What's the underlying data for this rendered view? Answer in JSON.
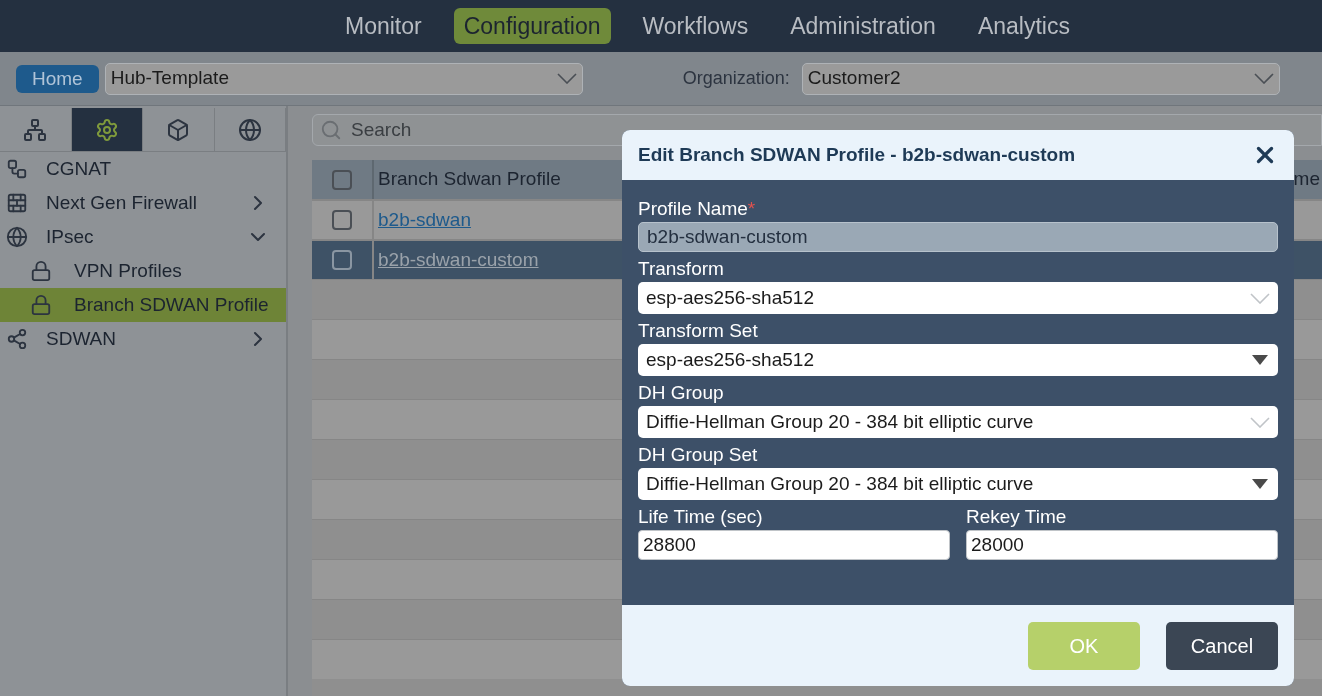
{
  "nav": {
    "items": [
      {
        "label": "Monitor",
        "selected": false
      },
      {
        "label": "Configuration",
        "selected": true
      },
      {
        "label": "Workflows",
        "selected": false
      },
      {
        "label": "Administration",
        "selected": false
      },
      {
        "label": "Analytics",
        "selected": false
      }
    ]
  },
  "toolbar": {
    "home": "Home",
    "template": "Hub-Template",
    "organization_label": "Organization:",
    "organization": "Customer2"
  },
  "sidebar": {
    "tabs": [
      {
        "selected": false
      },
      {
        "selected": true
      },
      {
        "selected": false
      },
      {
        "selected": false
      }
    ],
    "items": [
      {
        "label": "CGNAT",
        "selected": false
      },
      {
        "label": "Next Gen Firewall",
        "selected": false,
        "expanded": false
      },
      {
        "label": "IPsec",
        "selected": false,
        "expanded": true,
        "children": [
          {
            "label": "VPN Profiles",
            "selected": false
          },
          {
            "label": "Branch SDWAN Profile",
            "selected": true
          }
        ]
      },
      {
        "label": "SDWAN",
        "selected": false,
        "expanded": false
      }
    ]
  },
  "search": {
    "placeholder": "Search"
  },
  "table": {
    "header_checked": false,
    "columns": [
      "Branch Sdwan Profile",
      "me"
    ],
    "rows": [
      {
        "name": "b2b-sdwan",
        "selected": false,
        "checked": false
      },
      {
        "name": "b2b-sdwan-custom",
        "selected": true,
        "checked": false
      }
    ]
  },
  "dialog": {
    "title": "Edit Branch SDWAN Profile - b2b-sdwan-custom",
    "fields": [
      {
        "kind": "readonly",
        "label": "Profile Name",
        "required_mark": "*",
        "value": "b2b-sdwan-custom"
      },
      {
        "kind": "combo",
        "label": "Transform",
        "value": "esp-aes256-sha512"
      },
      {
        "kind": "select",
        "label": "Transform Set",
        "value": "esp-aes256-sha512"
      },
      {
        "kind": "combo",
        "label": "DH Group",
        "value": "Diffie-Hellman Group 20 - 384 bit elliptic curve"
      },
      {
        "kind": "select",
        "label": "DH Group Set",
        "value": "Diffie-Hellman Group 20 - 384 bit elliptic curve"
      }
    ],
    "pair": [
      {
        "label": "Life Time (sec)",
        "value": "28800"
      },
      {
        "label": "Rekey Time",
        "value": "28000"
      }
    ],
    "ok": "OK",
    "cancel": "Cancel"
  }
}
